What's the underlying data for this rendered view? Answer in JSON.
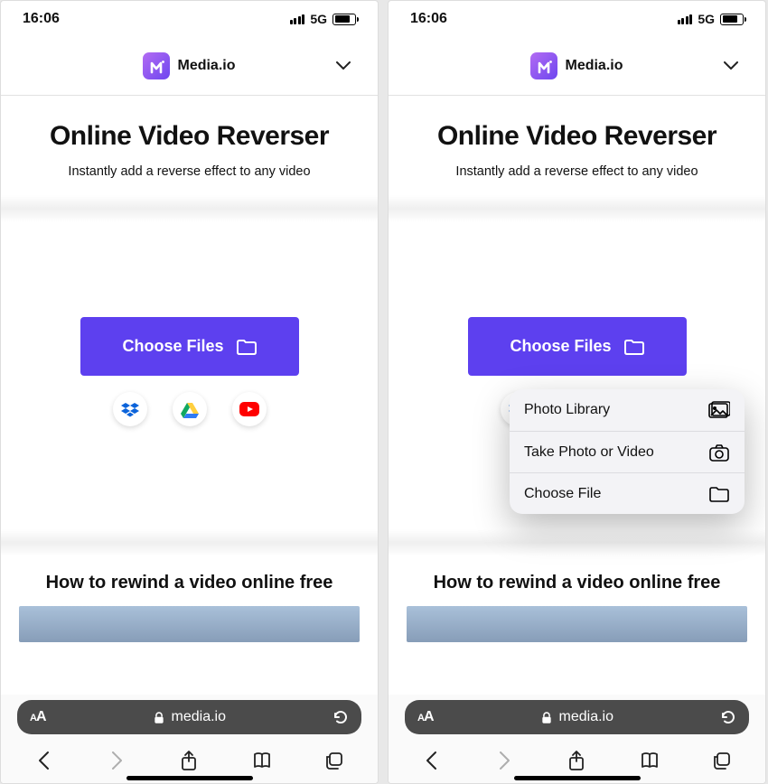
{
  "status": {
    "time": "16:06",
    "network": "5G"
  },
  "header": {
    "brand": "Media.io"
  },
  "hero": {
    "title": "Online Video Reverser",
    "subtitle": "Instantly add a reverse effect to any video"
  },
  "upload": {
    "button_label": "Choose Files",
    "alt_sources": [
      "Dropbox",
      "Google Drive",
      "YouTube"
    ]
  },
  "howto": {
    "heading": "How to rewind a video online free"
  },
  "urlbar": {
    "domain": "media.io"
  },
  "picker": {
    "items": [
      {
        "label": "Photo Library",
        "icon": "photos"
      },
      {
        "label": "Take Photo or Video",
        "icon": "camera"
      },
      {
        "label": "Choose File",
        "icon": "folder"
      }
    ]
  }
}
